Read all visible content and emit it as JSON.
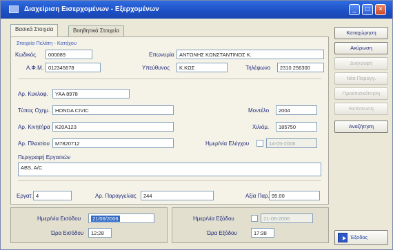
{
  "window": {
    "title": "Διαχείριση Εισερχομένων - Εξερχομένων"
  },
  "tabs": [
    {
      "label": "Βασικά Στοιχεία"
    },
    {
      "label": "Βοηθητικά Στοιχεία"
    }
  ],
  "section_client": {
    "title": "Στοιχεία Πελάτη - Κατόχου"
  },
  "client": {
    "code_label": "Κωδικός",
    "code_value": "000089",
    "name_label": "Επωνυμία",
    "name_value": "ΑΝΤΩΝΗΣ ΚΩΝΣΤΑΝΤΙΝΟΣ Κ.",
    "afm_label": "Α.Φ.Μ.",
    "afm_value": "012345678",
    "contact_label": "Υπεύθυνος",
    "contact_value": "Κ.ΚΩΣ",
    "phone_label": "Τηλέφωνο",
    "phone_value": "2310 256300"
  },
  "vehicle": {
    "plate_label": "Αρ. Κυκλοφ.",
    "plate_value": "ΥΑΑ 8978",
    "type_label": "Τύπος Οχημ.",
    "type_value": "HONDA CIVIC",
    "model_year_label": "Μοντέλο",
    "model_year_value": "2004",
    "engine_label": "Αρ. Κινητήρα",
    "engine_value": "K20A123",
    "km_label": "Χιλιόμ.",
    "km_value": "185750",
    "chassis_label": "Αρ. Πλαισίου",
    "chassis_value": "M7820712",
    "checkup_label": "Ημερ/νία Ελέγχου",
    "checkup_value": "14-05-2006",
    "description_label": "Περιγραφή Εργασιών",
    "description_value": "ABS, A/C"
  },
  "work": {
    "workers_label": "Εργατ.",
    "workers_value": "4",
    "order_label": "Αρ. Παραγγελίας",
    "order_value": "244",
    "value_label": "Αξία Παρ.",
    "value_value": "95.00"
  },
  "arrival": {
    "date_label": "Ημερ/νία Εισόδου",
    "date_value": "21/06/2006",
    "time_label": "Ώρα Εισόδου",
    "time_value": "12:28"
  },
  "departure": {
    "date_label": "Ημερ/νία Εξόδου",
    "date_value": "21-06-2006",
    "time_label": "Ώρα Εξόδου",
    "time_value": "17:38"
  },
  "buttons": {
    "new": "Καταχώρηση",
    "cancel": "Ακύρωση",
    "delete": "Διαγραφή",
    "new_order": "Νέα Παραγγ.",
    "print": "Προεπισκόπηση",
    "export": "Εκτύπωση",
    "search": "Αναζήτηση",
    "exit": "Έξοδος"
  },
  "colors": {
    "titlebar": "#1d4fc4",
    "label_text": "#1f2a7a",
    "selection": "#316ac5"
  }
}
